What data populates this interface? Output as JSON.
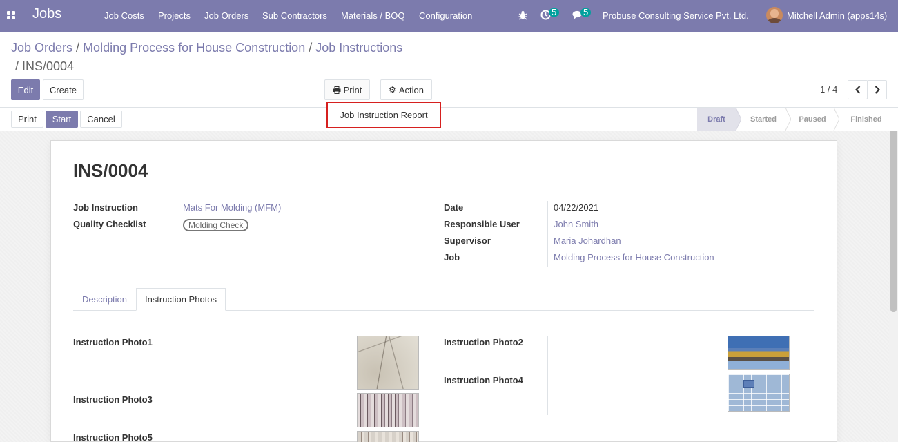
{
  "app": {
    "name": "Jobs"
  },
  "nav": {
    "menu": [
      "Job Costs",
      "Projects",
      "Job Orders",
      "Sub Contractors",
      "Materials / BOQ",
      "Configuration"
    ],
    "activity_count": "5",
    "messages_count": "5",
    "company": "Probuse Consulting Service Pvt. Ltd.",
    "user": "Mitchell Admin (apps14s)"
  },
  "breadcrumb": {
    "items": [
      "Job Orders",
      "Molding Process for House Construction",
      "Job Instructions"
    ],
    "current": "INS/0004"
  },
  "control": {
    "edit": "Edit",
    "create": "Create",
    "print": "Print",
    "action": "Action",
    "pager": "1 / 4"
  },
  "print_dropdown": {
    "items": [
      "Job Instruction Report"
    ]
  },
  "header_buttons": {
    "print": "Print",
    "start": "Start",
    "cancel": "Cancel"
  },
  "status": {
    "steps": [
      "Draft",
      "Started",
      "Paused",
      "Finished"
    ],
    "active": "Draft"
  },
  "record": {
    "name": "INS/0004",
    "left": {
      "job_instruction_label": "Job Instruction",
      "job_instruction": "Mats For Molding (MFM)",
      "quality_checklist_label": "Quality Checklist",
      "quality_checklist_tag": "Molding Check"
    },
    "right": {
      "date_label": "Date",
      "date": "04/22/2021",
      "responsible_label": "Responsible User",
      "responsible": "John Smith",
      "supervisor_label": "Supervisor",
      "supervisor": "Maria Johardhan",
      "job_label": "Job",
      "job": "Molding Process for House Construction"
    }
  },
  "tabs": {
    "description": "Description",
    "photos": "Instruction Photos",
    "active": "Instruction Photos"
  },
  "photos": {
    "photo1": "Instruction Photo1",
    "photo2": "Instruction Photo2",
    "photo3": "Instruction Photo3",
    "photo4": "Instruction Photo4",
    "photo5": "Instruction Photo5"
  },
  "colors": {
    "brand": "#7c7bad",
    "highlight": "#d6201f",
    "badge": "#00a09d"
  }
}
